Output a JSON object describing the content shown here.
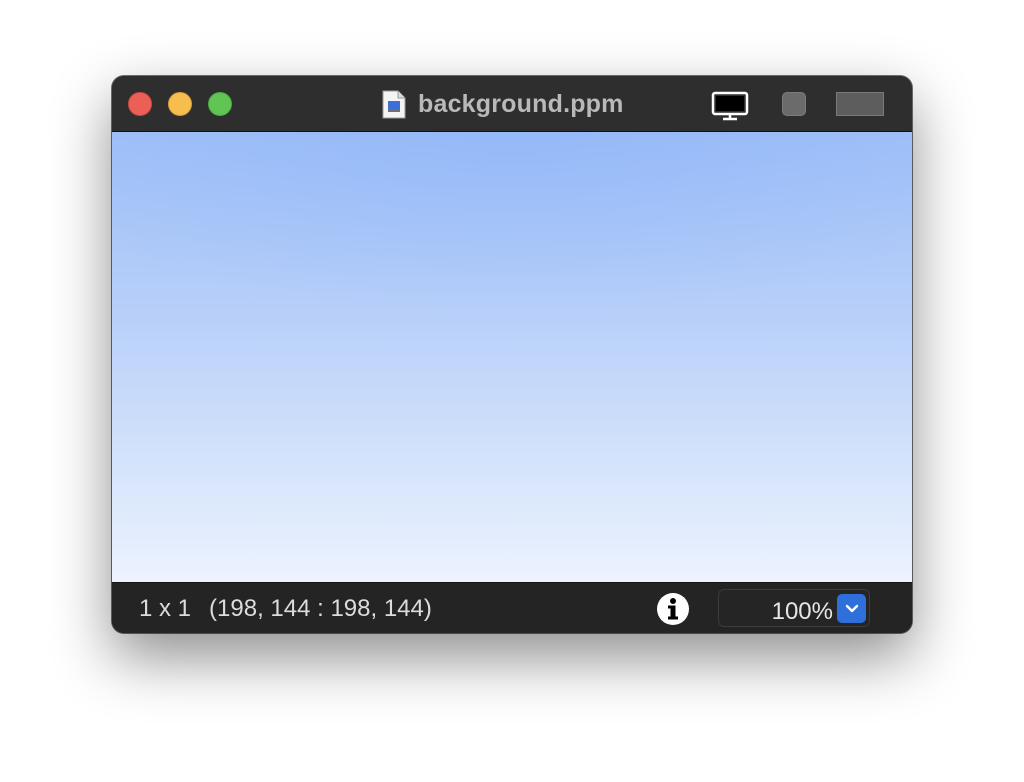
{
  "window": {
    "title": "background.ppm"
  },
  "titlebar": {
    "buttons": [
      "close",
      "minimize",
      "zoom"
    ],
    "icons": [
      "document-icon",
      "monitor-icon",
      "square-icon",
      "rectangle-icon"
    ]
  },
  "canvas": {
    "top_color": "#a0c0f8",
    "bottom_color": "#edf3fe"
  },
  "status": {
    "dimensions": "1 x 1",
    "selection": "(198, 144 : 198, 144)",
    "zoom": "100%"
  },
  "colors": {
    "close": "#ec5f57",
    "minimize": "#f5be4f",
    "maximize": "#61c554",
    "accent": "#2f6fdc"
  }
}
